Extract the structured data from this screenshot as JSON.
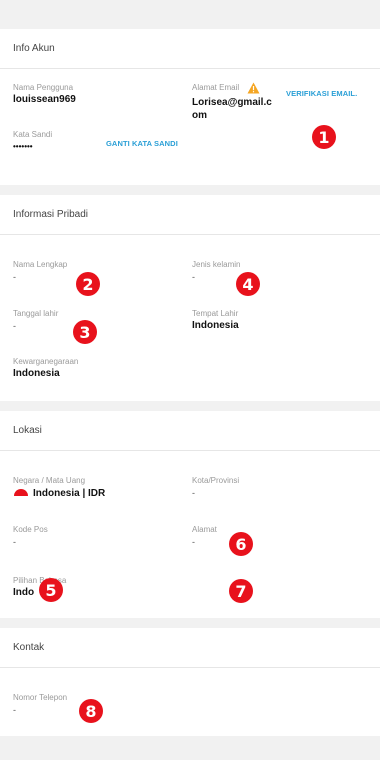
{
  "account": {
    "header": "Info Akun",
    "username_label": "Nama Pengguna",
    "username_value": "louissean969",
    "email_label": "Alamat Email",
    "email_value": "Lorisea@gmail.com",
    "verify_email_label": "VERIFIKASI EMAIL.",
    "password_label": "Kata Sandi",
    "password_value": "•••••••",
    "change_password_label": "GANTI KATA SANDI"
  },
  "personal": {
    "header": "Informasi Pribadi",
    "fullname_label": "Nama Lengkap",
    "fullname_value": "-",
    "gender_label": "Jenis kelamin",
    "gender_value": "-",
    "birthdate_label": "Tanggal lahir",
    "birthdate_value": "-",
    "birthplace_label": "Tempat Lahir",
    "birthplace_value": "Indonesia",
    "citizenship_label": "Kewarganegaraan",
    "citizenship_value": "Indonesia"
  },
  "location": {
    "header": "Lokasi",
    "country_label": "Negara / Mata Uang",
    "country_value": "Indonesia | IDR",
    "city_label": "Kota/Provinsi",
    "city_value": "-",
    "postal_label": "Kode Pos",
    "postal_value": "-",
    "address_label": "Alamat",
    "address_value": "-",
    "language_label": "Pilihan Bahasa",
    "language_value": "Indo"
  },
  "contact": {
    "header": "Kontak",
    "phone_label": "Nomor Telepon",
    "phone_value": "-"
  },
  "markers": [
    "1",
    "2",
    "3",
    "4",
    "5",
    "6",
    "7",
    "8"
  ],
  "colors": {
    "link": "#2a9fd6",
    "marker": "#e8121c",
    "warning": "#f5a623"
  },
  "icons": {
    "warning": "warning-icon",
    "flag": "indonesia-flag-icon"
  }
}
